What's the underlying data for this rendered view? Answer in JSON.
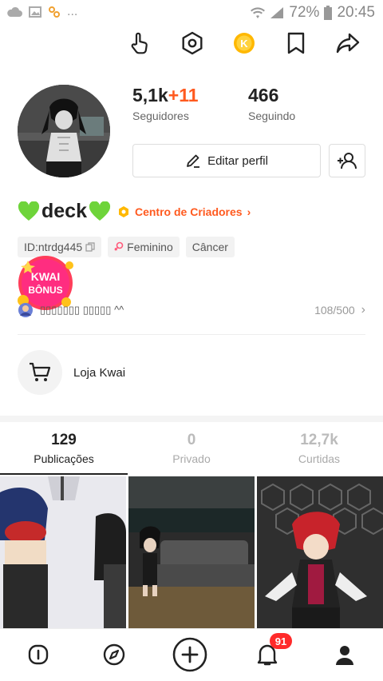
{
  "status_bar": {
    "battery": "72%",
    "time": "20:45",
    "dots": "..."
  },
  "top_icons": [
    "hand-pointer-icon",
    "settings-hexagon-icon",
    "kwai-coin-icon",
    "bookmark-icon",
    "share-icon"
  ],
  "profile": {
    "followers_count": "5,1k",
    "followers_delta": "+11",
    "followers_label": "Seguidores",
    "following_count": "466",
    "following_label": "Seguindo",
    "edit_label": "Editar perfil",
    "name": "deck",
    "creator_center": "Centro de Criadores",
    "creator_arrow": "›"
  },
  "tags": {
    "id": "ID:ntrdg445",
    "gender": "Feminino",
    "sign": "Câncer"
  },
  "kwai_bonus": {
    "line1": "KWAI",
    "line2": "BÔNUS"
  },
  "bio": {
    "text": "▯▯▯▯▯▯▯ ▯▯▯▯▯ ^^",
    "count": "108/500",
    "arrow": "›"
  },
  "shop": {
    "label": "Loja Kwai"
  },
  "tabs": [
    {
      "count": "129",
      "label": "Publicações"
    },
    {
      "count": "0",
      "label": "Privado"
    },
    {
      "count": "12,7k",
      "label": "Curtidas"
    }
  ],
  "bottom_nav": {
    "notification_badge": "91"
  },
  "colors": {
    "accent": "#ff5a1f",
    "badge": "#ff2a2a",
    "heart": "#6ed43a"
  }
}
